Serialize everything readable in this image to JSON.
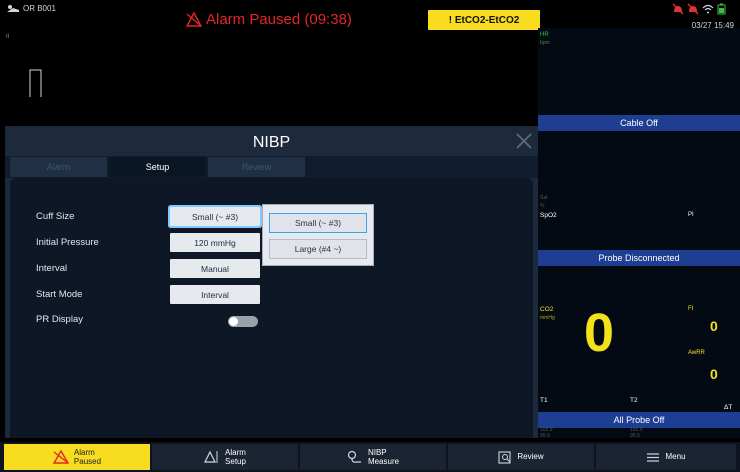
{
  "topbar": {
    "bed_label": "OR B001",
    "alarm_banner": "Alarm Paused (09:38)",
    "tech_alarm": "! EtCO2-EtCO2",
    "datetime": "03/27 15:49",
    "left_tiny": "II"
  },
  "params": {
    "hr_label": "HR",
    "hr_unit": "bpm",
    "cable_status": "Cable Off",
    "spo2_label": "SpO2",
    "spo2_sub1": "Sat",
    "spo2_sub2": "%",
    "pi_label": "PI",
    "probe_status": "Probe Disconnected",
    "co2_label": "CO2",
    "co2_unit": "mmHg",
    "co2_value": "0",
    "fi_label": "FI",
    "fi_value": "0",
    "awrr_label": "AwRR",
    "awrr_value": "0",
    "t1_label": "T1",
    "t2_label": "T2",
    "dt_label": "ΔT",
    "temp_status": "All Probe Off",
    "t1_range": "102.9\n95.0",
    "t2_range": "102.9\n95.0"
  },
  "dialog": {
    "title": "NIBP",
    "tabs": [
      {
        "label": "Alarm",
        "active": false
      },
      {
        "label": "Setup",
        "active": true
      },
      {
        "label": "Review",
        "active": false
      }
    ],
    "rows": {
      "cuff_size": {
        "label": "Cuff Size",
        "value": "Small (~ #3)"
      },
      "initial_pressure": {
        "label": "Initial Pressure",
        "value": "120 mmHg"
      },
      "interval": {
        "label": "Interval",
        "value": "Manual"
      },
      "start_mode": {
        "label": "Start Mode",
        "value": "Interval"
      },
      "pr_display": {
        "label": "PR Display",
        "on": false
      }
    },
    "dropdown_options": [
      {
        "label": "Small (~ #3)",
        "selected": true
      },
      {
        "label": "Large (#4 ~)",
        "selected": false
      }
    ]
  },
  "softkeys": {
    "alarm_paused": "Alarm\nPaused",
    "alarm_setup": "Alarm\nSetup",
    "nibp_measure": "NIBP\nMeasure",
    "review": "Review",
    "menu": "Menu"
  },
  "colors": {
    "alarm_red": "#e32626",
    "alarm_yellow": "#f7dc1f",
    "co2_yellow": "#f3e21a",
    "status_blue": "#1e3e92",
    "dialog_bg": "#1c2a3c"
  },
  "icons": [
    "bed-person-icon",
    "alarm-off-bell-icon",
    "alarm-paused-icon",
    "battery-icon",
    "wifi-icon",
    "close-icon",
    "alarm-setup-icon",
    "nibp-cuff-icon",
    "review-icon",
    "menu-icon"
  ]
}
